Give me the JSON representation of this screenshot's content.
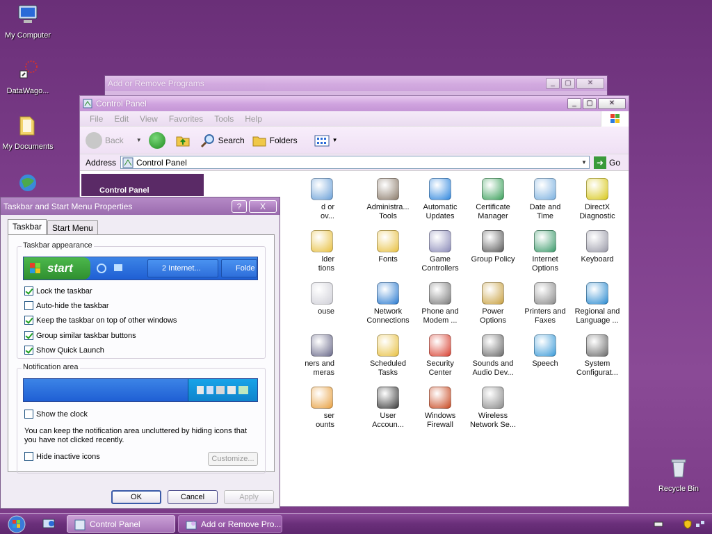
{
  "desktop": {
    "icons": [
      {
        "label": "My Computer"
      },
      {
        "label": "DataWago..."
      },
      {
        "label": "My Documents"
      },
      {
        "label": "Recycle Bin"
      }
    ]
  },
  "add_remove_window": {
    "title": "Add or Remove Programs"
  },
  "control_panel": {
    "title": "Control Panel",
    "menu": [
      "File",
      "Edit",
      "View",
      "Favorites",
      "Tools",
      "Help"
    ],
    "toolbar": {
      "back": "Back",
      "search": "Search",
      "folders": "Folders"
    },
    "address_label": "Address",
    "address_value": "Control Panel",
    "go": "Go",
    "side_title": "Control Panel",
    "items": [
      {
        "label": "d or\nov...",
        "color": "#6aa0d8"
      },
      {
        "label": "Administra...\nTools",
        "color": "#8a7a6a"
      },
      {
        "label": "Automatic\nUpdates",
        "color": "#2e86de"
      },
      {
        "label": "Certificate\nManager",
        "color": "#3aa05a"
      },
      {
        "label": "Date and\nTime",
        "color": "#7ab0e0"
      },
      {
        "label": "DirectX\nDiagnostic",
        "color": "#d8c818"
      },
      {
        "label": "lder\ntions",
        "color": "#e8c040"
      },
      {
        "label": "Fonts",
        "color": "#e8c040"
      },
      {
        "label": "Game\nControllers",
        "color": "#8a8ab8"
      },
      {
        "label": "Group Policy",
        "color": "#5a5a5a"
      },
      {
        "label": "Internet\nOptions",
        "color": "#3a9a6a"
      },
      {
        "label": "Keyboard",
        "color": "#9a9aa8"
      },
      {
        "label": "ouse",
        "color": "#d0d0d8"
      },
      {
        "label": "Network\nConnections",
        "color": "#2a7ad0"
      },
      {
        "label": "Phone and\nModem ...",
        "color": "#7a7a7a"
      },
      {
        "label": "Power\nOptions",
        "color": "#c8a040"
      },
      {
        "label": "Printers and\nFaxes",
        "color": "#8a8a8a"
      },
      {
        "label": "Regional and\nLanguage ...",
        "color": "#2a8ad0"
      },
      {
        "label": "ners and\nmeras",
        "color": "#6a6a8a"
      },
      {
        "label": "Scheduled\nTasks",
        "color": "#e8c040"
      },
      {
        "label": "Security\nCenter",
        "color": "#d84030"
      },
      {
        "label": "Sounds and\nAudio Dev...",
        "color": "#6a6a6a"
      },
      {
        "label": "Speech",
        "color": "#3a9ad8"
      },
      {
        "label": "System\nConfigurat...",
        "color": "#6a6a6a"
      },
      {
        "label": "ser\nounts",
        "color": "#e8a040"
      },
      {
        "label": "User\nAccoun...",
        "color": "#3a3a3a"
      },
      {
        "label": "Windows\nFirewall",
        "color": "#c84820"
      },
      {
        "label": "Wireless\nNetwork Se...",
        "color": "#8a8a8a"
      }
    ]
  },
  "dialog": {
    "title": "Taskbar and Start Menu Properties",
    "help": "?",
    "close": "X",
    "tabs": [
      "Taskbar",
      "Start Menu"
    ],
    "appearance_legend": "Taskbar appearance",
    "preview": {
      "start": "start",
      "task1": "2 Internet...",
      "task2": "Folde"
    },
    "options": [
      {
        "label": "Lock the taskbar",
        "checked": true
      },
      {
        "label": "Auto-hide the taskbar",
        "checked": false
      },
      {
        "label": "Keep the taskbar on top of other windows",
        "checked": true
      },
      {
        "label": "Group similar taskbar buttons",
        "checked": true
      },
      {
        "label": "Show Quick Launch",
        "checked": true
      }
    ],
    "notification_legend": "Notification area",
    "show_clock": {
      "label": "Show the clock",
      "checked": false
    },
    "notification_text": "You can keep the notification area uncluttered by hiding icons that you have not clicked recently.",
    "hide_inactive": {
      "label": "Hide inactive icons",
      "checked": false
    },
    "customize": "Customize...",
    "ok": "OK",
    "cancel": "Cancel",
    "apply": "Apply"
  },
  "taskbar": {
    "tasks": [
      {
        "label": "Control Panel",
        "active": true
      },
      {
        "label": "Add or Remove Pro...",
        "active": false
      }
    ]
  },
  "colors": {
    "desktop": "#7e3f8c",
    "accent": "#a577b8"
  }
}
